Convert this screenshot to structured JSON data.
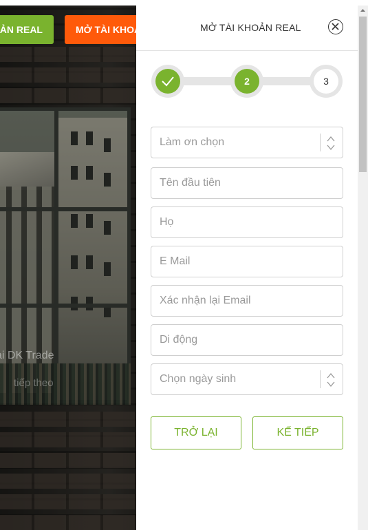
{
  "background": {
    "open_real_account_short": "ẢN REAL",
    "open_account_short": "MỞ TÀI KHOẢ",
    "overlay_text_1": "ại DK Trade",
    "overlay_text_2": "tiếp theo"
  },
  "panel": {
    "title": "MỞ TÀI KHOẢN REAL",
    "close_icon": "close-circle-icon",
    "steps": [
      {
        "label": "",
        "state": "done"
      },
      {
        "label": "2",
        "state": "active"
      },
      {
        "label": "3",
        "state": "todo"
      }
    ],
    "fields": {
      "title_select": "Làm ơn chọn",
      "first_name": "Tên đầu tiên",
      "last_name": "Họ",
      "email": "E Mail",
      "confirm_email": "Xác nhận lại Email",
      "mobile": "Di động",
      "birthdate_select": "Chọn ngày sinh"
    },
    "buttons": {
      "back": "TRỞ LẠI",
      "next": "KẾ TIẾP"
    }
  },
  "colors": {
    "green": "#7ab32e",
    "orange": "#ff5a0a"
  }
}
